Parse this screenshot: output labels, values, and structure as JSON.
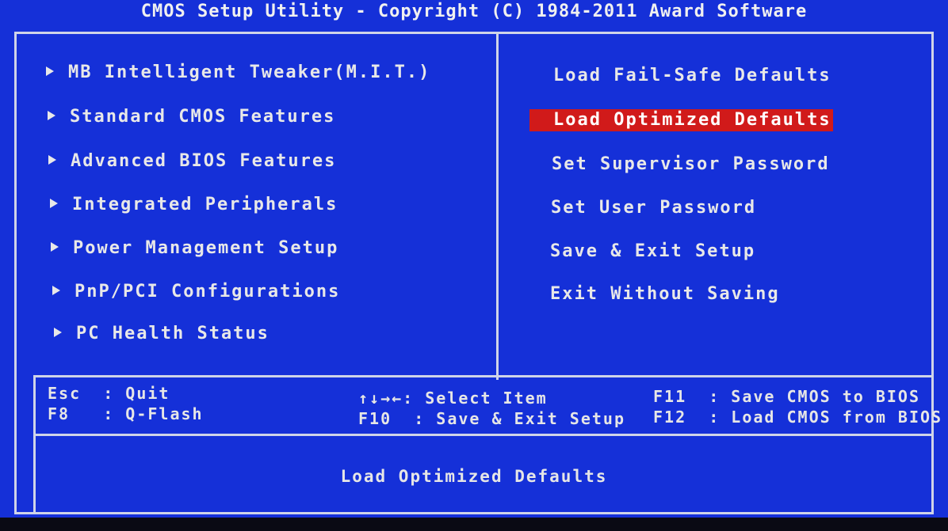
{
  "title": "CMOS Setup Utility - Copyright (C) 1984-2011 Award Software",
  "left_menu": [
    {
      "label": "MB Intelligent Tweaker(M.I.T.)"
    },
    {
      "label": "Standard CMOS Features"
    },
    {
      "label": "Advanced BIOS Features"
    },
    {
      "label": "Integrated Peripherals"
    },
    {
      "label": "Power Management Setup"
    },
    {
      "label": "PnP/PCI Configurations"
    },
    {
      "label": "PC Health Status"
    }
  ],
  "right_menu": [
    {
      "label": "Load Fail-Safe Defaults"
    },
    {
      "label": "Load Optimized Defaults"
    },
    {
      "label": "Set Supervisor Password"
    },
    {
      "label": "Set User Password"
    },
    {
      "label": "Save & Exit Setup"
    },
    {
      "label": "Exit Without Saving"
    }
  ],
  "selected_item": "Load Optimized Defaults",
  "key_help": {
    "col1": [
      "Esc  : Quit",
      "F8   : Q-Flash"
    ],
    "col2": [
      "↑↓→←: Select Item",
      "F10  : Save & Exit Setup"
    ],
    "col3": [
      "F11  : Save CMOS to BIOS",
      "F12  : Load CMOS from BIOS"
    ]
  },
  "status_text": "Load Optimized Defaults",
  "colors": {
    "background": "#1530d8",
    "highlight": "#d11a1a",
    "text": "#e8e8e8"
  }
}
